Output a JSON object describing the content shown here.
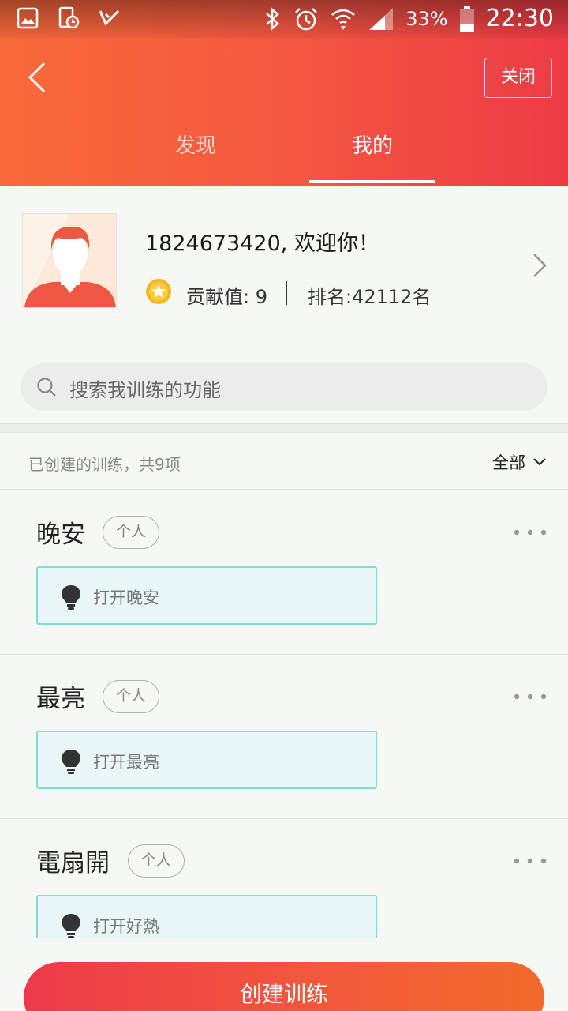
{
  "status_bar": {
    "battery": "33%",
    "time": "22:30"
  },
  "header": {
    "close_label": "关闭",
    "tabs": [
      {
        "label": "发现",
        "active": false
      },
      {
        "label": "我的",
        "active": true
      }
    ],
    "accent_colors": [
      "#f96a3a",
      "#ec3b45"
    ]
  },
  "profile": {
    "greeting": "1824673420, 欢迎你！",
    "contribution": "贡献值: 9",
    "rank": "排名:42112名"
  },
  "search": {
    "placeholder": "搜索我训练的功能"
  },
  "list": {
    "count_text": "已创建的训练，共9项",
    "filter_label": "全部",
    "items": [
      {
        "title": "晚安",
        "tag": "个人",
        "command": "打开晚安"
      },
      {
        "title": "最亮",
        "tag": "个人",
        "command": "打开最亮"
      },
      {
        "title": "電扇開",
        "tag": "个人",
        "command": "打开好熱"
      }
    ]
  },
  "create_button": {
    "label": "创建训练"
  }
}
